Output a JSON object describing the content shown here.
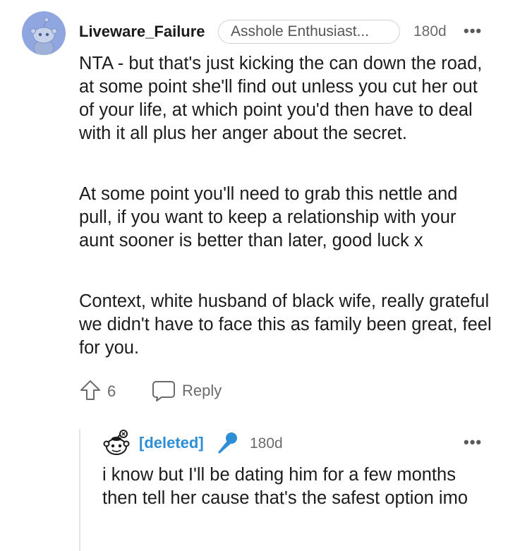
{
  "comment": {
    "username": "Liveware_Failure",
    "flair": "Asshole Enthusiast...",
    "age": "180d",
    "more_glyph": "•••",
    "paragraphs": [
      "NTA - but that's just kicking the can down the road, at some point she'll find out unless you cut her out of your life, at which point you'd then have to deal with it all plus her anger about the secret.",
      "At some point you'll need to grab this nettle and pull, if you want to keep a relationship with your aunt sooner is better than later, good luck x",
      "Context, white husband of black wife, really grateful we didn't have to face this as family been great, feel for you."
    ],
    "upvotes": "6",
    "reply_label": "Reply",
    "avatar_icon": "snoo-avatar-icon"
  },
  "reply": {
    "username": "[deleted]",
    "op_icon": "microphone-icon",
    "age": "180d",
    "more_glyph": "•••",
    "text": "i know but I'll be dating him for a few months then tell her cause that's the safest option imo"
  },
  "colors": {
    "accent_blue": "#2d8ed6",
    "avatar_bg": "#8fa6e0",
    "muted_text": "#6b6b6b"
  }
}
